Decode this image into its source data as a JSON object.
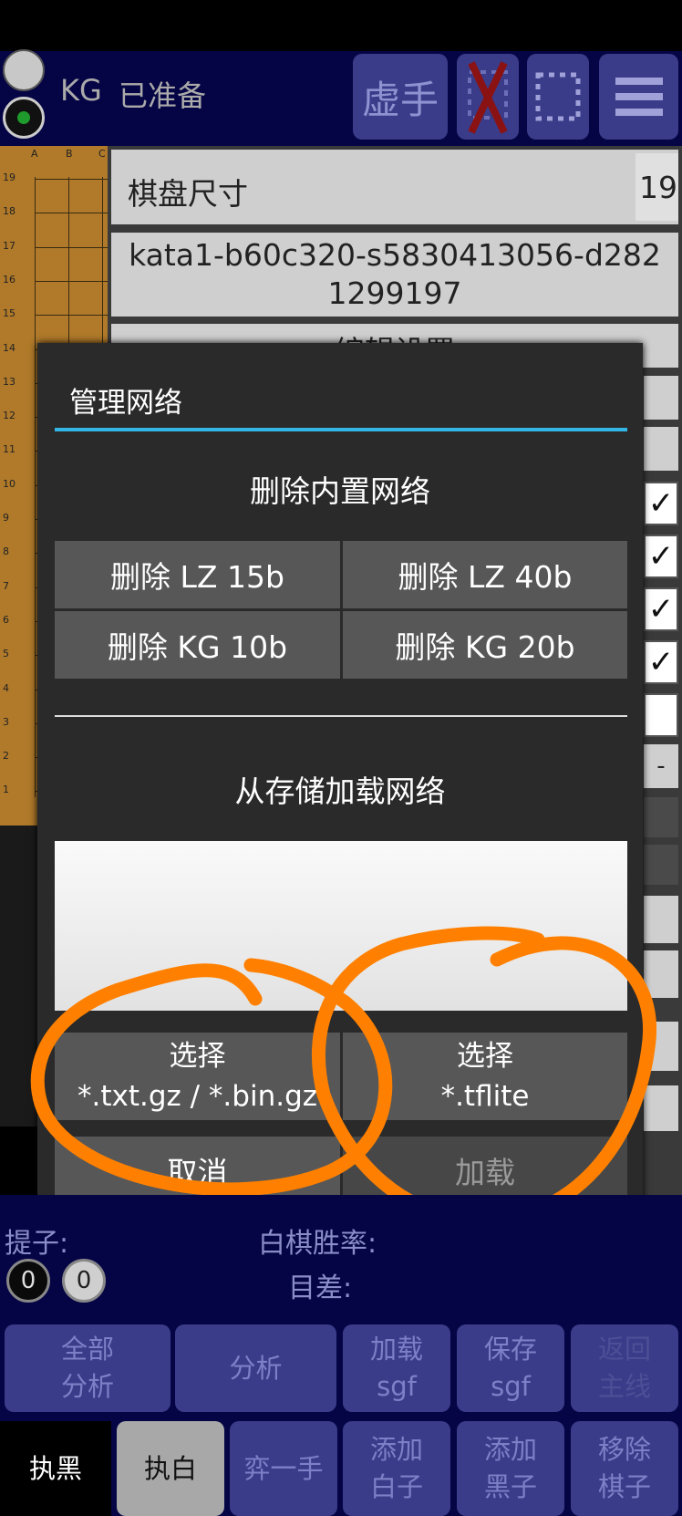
{
  "status": {
    "engine": "KG",
    "state": "已准备"
  },
  "toolbar": {
    "pass_label": "虚手",
    "remove_icon": "x-icon",
    "select_icon": "dashed-square-icon",
    "menu_icon": "hamburger-menu-icon"
  },
  "board": {
    "col_labels": [
      "A",
      "B",
      "C"
    ],
    "row_labels": [
      "19",
      "18",
      "17",
      "16",
      "15",
      "14",
      "13",
      "12",
      "11",
      "10",
      "9",
      "8",
      "7",
      "6",
      "5",
      "4",
      "3",
      "2",
      "1"
    ]
  },
  "settings": {
    "board_size_label": "棋盘尺寸",
    "board_size_value": "19",
    "network_name": "kata1-b60c320-s5830413056-d2821299197",
    "edit_settings_label": "编辑设置",
    "dash_label": "-"
  },
  "dialog": {
    "title": "管理网络",
    "delete_section_title": "删除内置网络",
    "delete_buttons": [
      "删除 LZ 15b",
      "删除 LZ 40b",
      "删除 KG 10b",
      "删除 KG 20b"
    ],
    "load_section_title": "从存储加载网络",
    "select_gz_label_1": "选择",
    "select_gz_label_2": "*.txt.gz / *.bin.gz",
    "select_tflite_label_1": "选择",
    "select_tflite_label_2": "*.tflite",
    "cancel_label": "取消",
    "load_label": "加载"
  },
  "info": {
    "captures_label": "提子:",
    "black_captures": "0",
    "white_captures": "0",
    "winrate_label": "白棋胜率:",
    "score_label": "目差:"
  },
  "bottom_row1": [
    {
      "line1": "全部",
      "line2": "分析"
    },
    {
      "line1": "分析",
      "line2": ""
    },
    {
      "line1": "加载",
      "line2": "sgf"
    },
    {
      "line1": "保存",
      "line2": "sgf"
    },
    {
      "line1": "返回",
      "line2": "主线"
    }
  ],
  "bottom_row2": [
    {
      "line1": "执黑",
      "line2": ""
    },
    {
      "line1": "执白",
      "line2": ""
    },
    {
      "line1": "弈一手",
      "line2": ""
    },
    {
      "line1": "添加",
      "line2": "白子"
    },
    {
      "line1": "添加",
      "line2": "黑子"
    },
    {
      "line1": "移除",
      "line2": "棋子"
    }
  ],
  "colors": {
    "accent": "#33b5e5",
    "annotation": "#ff8000",
    "bar_bg": "#050545",
    "button_bg": "#3a3c8a"
  }
}
